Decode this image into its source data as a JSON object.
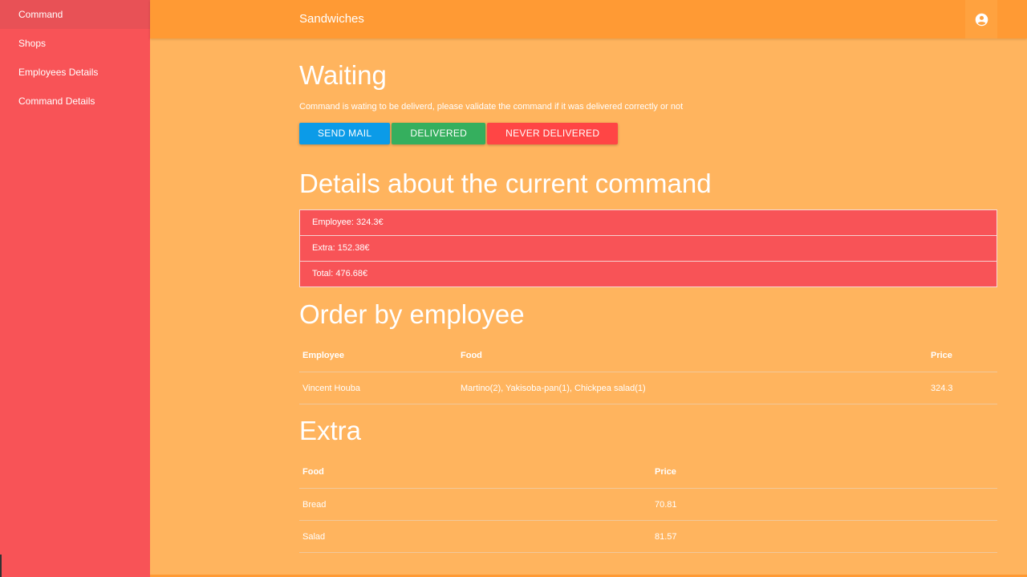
{
  "sidebar": {
    "items": [
      {
        "label": "Command"
      },
      {
        "label": "Shops"
      },
      {
        "label": "Employees Details"
      },
      {
        "label": "Command Details"
      }
    ]
  },
  "header": {
    "title": "Sandwiches",
    "account_icon": "account-circle-icon"
  },
  "status": {
    "title": "Waiting",
    "message": "Command is wating to be deliverd, please validate the command if it was delivered correctly or not",
    "buttons": {
      "send_mail": "SEND MAIL",
      "delivered": "DELIVERED",
      "never_delivered": "NEVER DELIVERED"
    }
  },
  "details": {
    "title": "Details about the current command",
    "rows": [
      "Employee: 324.3€",
      "Extra: 152.38€",
      "Total: 476.68€"
    ]
  },
  "order": {
    "title": "Order by employee",
    "columns": [
      "Employee",
      "Food",
      "Price"
    ],
    "rows": [
      [
        "Vincent Houba",
        "Martino(2), Yakisoba-pan(1), Chickpea salad(1)",
        "324.3"
      ]
    ]
  },
  "extra": {
    "title": "Extra",
    "columns": [
      "Food",
      "Price"
    ],
    "rows": [
      [
        "Bread",
        "70.81"
      ],
      [
        "Salad",
        "81.57"
      ]
    ]
  },
  "colors": {
    "sidebar": "#F85357",
    "topbar": "#FF9A34",
    "background": "#FFB45E",
    "send_mail": "#0B9BE8",
    "delivered": "#35AF5E",
    "never_delivered": "#FF4545"
  }
}
